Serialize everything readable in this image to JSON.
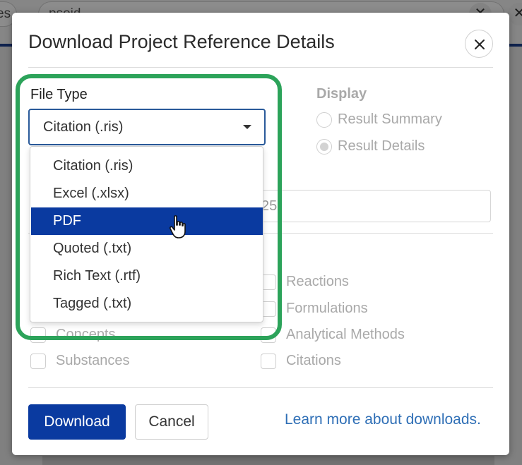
{
  "background": {
    "tab_fragment": "es",
    "search_fragment": "psoid",
    "close_glyph": "✕"
  },
  "modal": {
    "title": "Download Project Reference Details",
    "close_icon": "close-icon"
  },
  "file_type": {
    "label": "File Type",
    "selected_value": "Citation (.ris)",
    "options": [
      "Citation (.ris)",
      "Excel (.xlsx)",
      "PDF",
      "Quoted (.txt)",
      "Rich Text (.rtf)",
      "Tagged (.txt)"
    ],
    "highlighted_option": "PDF"
  },
  "display": {
    "label": "Display",
    "options": [
      "Result Summary",
      "Result Details"
    ],
    "selected": "Result Details"
  },
  "range_input": {
    "value_fragment": "25"
  },
  "sections": {
    "left": [
      "Concepts",
      "Substances"
    ],
    "right": [
      "Reactions",
      "Formulations",
      "Analytical Methods",
      "Citations"
    ]
  },
  "footer": {
    "download_label": "Download",
    "cancel_label": "Cancel",
    "learn_more_label": "Learn more about downloads."
  },
  "colors": {
    "primary": "#0a3aa0",
    "highlight_ring": "#2ca35a",
    "link": "#2f6fb6"
  }
}
